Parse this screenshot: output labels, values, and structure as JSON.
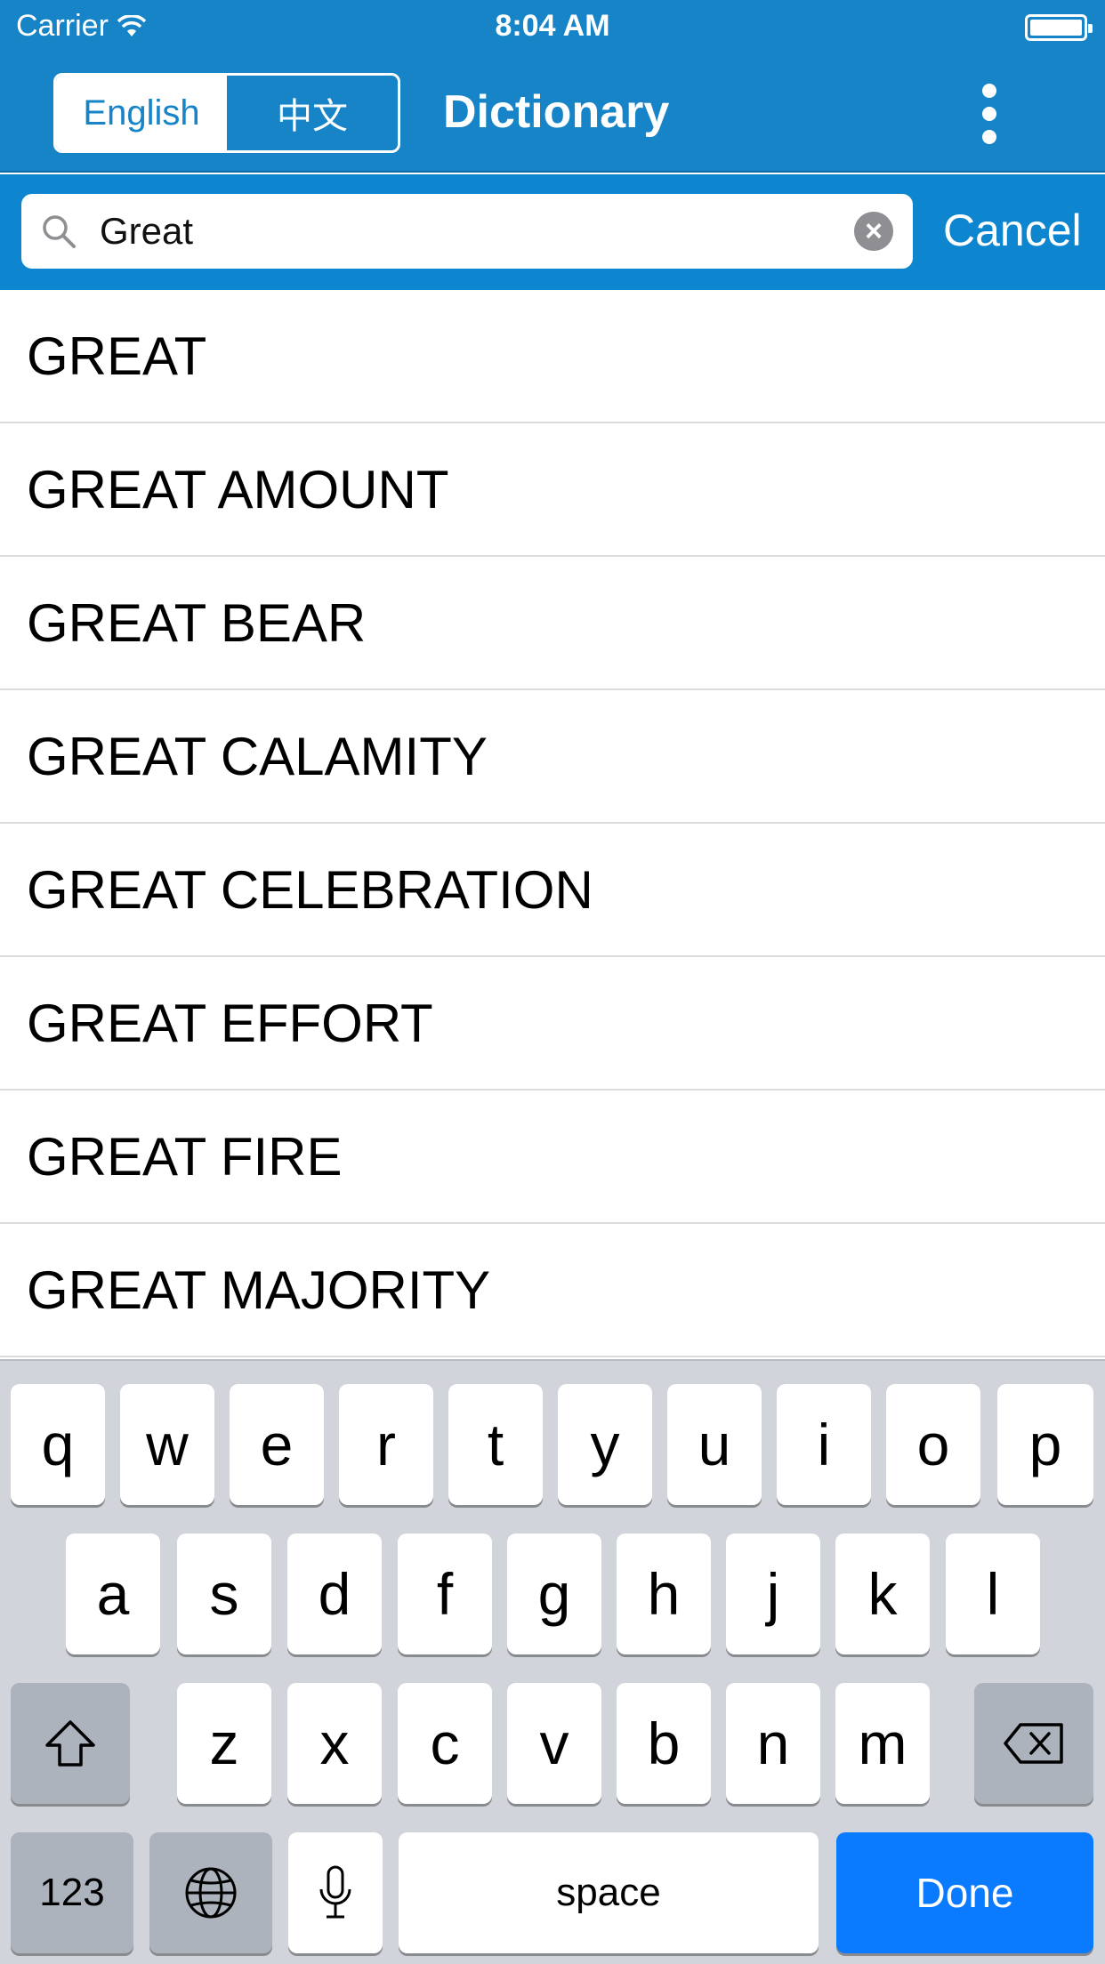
{
  "status": {
    "carrier": "Carrier",
    "time": "8:04 AM"
  },
  "nav": {
    "segments": [
      "English",
      "中文"
    ],
    "selected_segment": "English",
    "title": "Dictionary"
  },
  "search": {
    "value": "Great",
    "cancel_label": "Cancel"
  },
  "results": [
    "GREAT",
    "GREAT AMOUNT",
    "GREAT BEAR",
    "GREAT CALAMITY",
    "GREAT CELEBRATION",
    "GREAT EFFORT",
    "GREAT FIRE",
    "GREAT MAJORITY"
  ],
  "keyboard": {
    "row1": [
      "q",
      "w",
      "e",
      "r",
      "t",
      "y",
      "u",
      "i",
      "o",
      "p"
    ],
    "row2": [
      "a",
      "s",
      "d",
      "f",
      "g",
      "h",
      "j",
      "k",
      "l"
    ],
    "row3": [
      "z",
      "x",
      "c",
      "v",
      "b",
      "n",
      "m"
    ],
    "numbers_label": "123",
    "space_label": "space",
    "done_label": "Done"
  },
  "colors": {
    "header": "#1684c6",
    "search_bar": "#0e85cf",
    "done_key": "#0a7aff"
  }
}
